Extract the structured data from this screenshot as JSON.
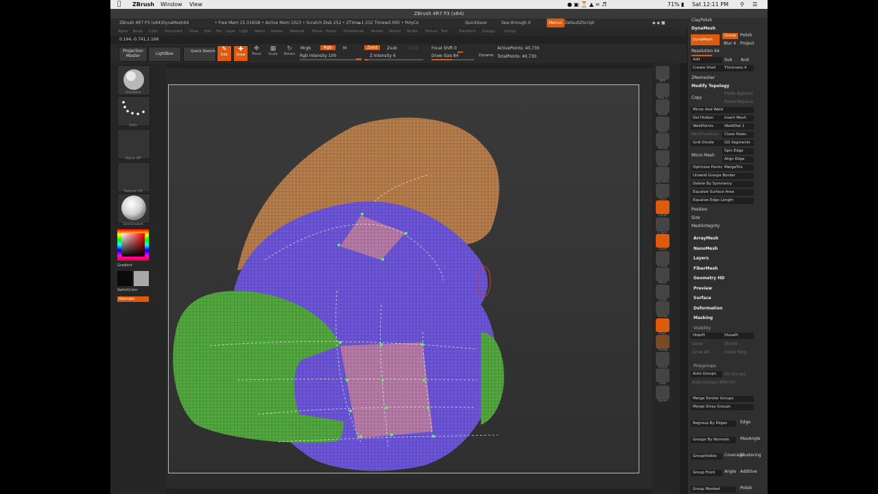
{
  "mac_menubar": {
    "app_name": "ZBrush",
    "menu_window": "Window",
    "menu_view": "View",
    "clock": "Sat 12:11 PM",
    "battery": "71%"
  },
  "window_title": "ZBrush 4R7 P3 (x64)",
  "infobar": {
    "doc_name": "ZBrush 4R7 P3 (x64)DynaMesh64",
    "stats": "• Free Mem 15.316GB • Active Mem 1023 • Scratch Disk 252 • ZTime▸1.332 Timer▸0.005 • PolyCo",
    "quicksave": "QuickSave",
    "see_through": "See-through  0",
    "menus": "Menus",
    "default_script": "DefaultZScript"
  },
  "main_menu": [
    "Alpha",
    "Brush",
    "Color",
    "Document",
    "Draw",
    "Edit",
    "File",
    "Layer",
    "Light",
    "Macro",
    "Marker",
    "Material",
    "Movie",
    "Picker",
    "Preferences",
    "Render",
    "Stencil",
    "Stroke",
    "Texture",
    "Tool",
    "Transform",
    "Zplugin",
    "Zscript"
  ],
  "coords": "0.194,-0.741,1.166",
  "toolbar": {
    "projection_master": "Projection Master",
    "lightbox": "LightBox",
    "quick_sketch": "Quick Sketch",
    "edit": "Edit",
    "draw": "Draw",
    "move": "Move",
    "scale": "Scale",
    "rotate": "Rotate",
    "mrgb": "Mrgb",
    "rgb": "Rgb",
    "m": "M",
    "rgb_intensity": "Rgb Intensity 100",
    "zadd": "Zadd",
    "zsub": "Zsub",
    "zcut": "Zcut",
    "z_intensity": "Z Intensity 6",
    "focal_shift": "Focal Shift 0",
    "draw_size": "Draw Size 84",
    "dynamic": "Dynamic",
    "active_points": "ActivePoints: 40,730",
    "total_points": "TotalPoints: 40,730"
  },
  "left_shelf": {
    "labels": [
      "Standard",
      "Dots",
      "Alpha Off",
      "Texture Off",
      "SkinShade4"
    ],
    "gradient": "Gradient",
    "switch_color": "SwitchColor",
    "alternate": "Alternate"
  },
  "right_shelf": [
    "BPR",
    "SPix 3",
    "Scroll",
    "Zoom",
    "Actual",
    "AAHalf",
    "Dynamic Persp",
    "Floor",
    "Local",
    "L.Sym",
    "Gxyz",
    "Frame",
    "Move",
    "Scale",
    "Rotate",
    "PolyF",
    "Transp",
    "Ghost",
    "Solo",
    "Xpose"
  ],
  "palette": {
    "claypolish": "ClayPolish",
    "dynamesh_header": "DynaMesh",
    "dynamesh_btn": "DynaMesh",
    "group": "Group",
    "polish": "Polish",
    "blur": "Blur 4",
    "project": "Project",
    "resolution": "Resolution 64",
    "add": "Add",
    "sub": "Sub",
    "and": "And",
    "create_shell": "Create Shell",
    "thickness": "Thickness 4",
    "zremesher": "ZRemesher",
    "modify_topology": "Modify Topology",
    "copy": "Copy",
    "paste_append": "Paste Append",
    "paste_replace": "Paste Replace",
    "mirror_and_weld": "Mirror And Weld",
    "del_hidden": "Del Hidden",
    "insert_mesh": "Insert Mesh",
    "weldpoints": "WeldPoints",
    "welddist": "WeldDist 1",
    "mesh_from_brush": "MeshFromBrush",
    "close_holes": "Close Holes",
    "grid_divide": "Grid Divide",
    "gd_segments": "GD Segments",
    "spin_edge": "Spin Edge",
    "micro_mesh": "Micro Mesh",
    "align_edge": "Align Edge",
    "optimize_points": "Optimize Points",
    "merge_tris": "MergeTris",
    "unweld_groups_border": "Unweld Groups Border",
    "delete_by_symmetry": "Delete By Symmetry",
    "equalize_surface_area": "Equalize Surface Area",
    "equalize_edge_length": "Equalize Edge Length",
    "position": "Position",
    "size": "Size",
    "mesh_integrity": "MeshIntegrity",
    "sections": [
      "ArrayMesh",
      "NanoMesh",
      "Layers",
      "FiberMesh",
      "Geometry HD",
      "Preview",
      "Surface",
      "Deformation",
      "Masking"
    ],
    "visibility": "Visibility",
    "hidept": "HidePt",
    "showpt": "ShowPt",
    "grow": "Grow",
    "shrink": "Shrink",
    "grow_all": "Grow All",
    "outer_ring": "Outer Ring",
    "polygroups": "Polygroups",
    "auto_groups": "Auto Groups",
    "uv_groups": "Uv Groups",
    "auto_groups_uv": "Auto Groups With UV",
    "merge_similar_groups": "Merge Similar Groups",
    "merge_stray_groups": "Merge Stray Groups",
    "regroup_by_edges": "Regroup By Edges",
    "edge": "Edge",
    "groups_by_normals": "Groups By Normals",
    "maxangle": "MaxAngle",
    "groupvisible": "GroupVisible",
    "coverage": "Coverage",
    "clustering": "Clustering",
    "group_front": "Group Front",
    "angle": "Angle",
    "additive": "Additive",
    "group_masked": "Group Masked",
    "polish_bottom": "Polish"
  },
  "colors": {
    "accent_orange": "#e05a0c",
    "mesh_purple": "#6e4fcf",
    "mesh_green": "#4e9a3a",
    "mesh_tan": "#b07a4a",
    "mesh_pink": "#c07a9a"
  }
}
